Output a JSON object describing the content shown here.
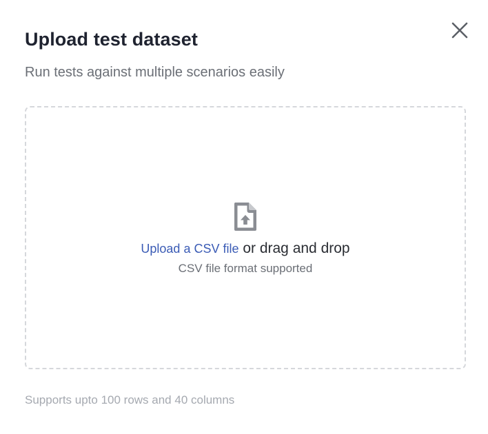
{
  "dialog": {
    "title": "Upload test dataset",
    "subtitle": "Run tests against multiple scenarios easily",
    "close_icon": "close-icon"
  },
  "dropzone": {
    "icon": "file-upload-icon",
    "upload_link": "Upload a CSV file",
    "drag_text": " or drag and drop",
    "hint": "CSV file format supported"
  },
  "footer": {
    "note": "Supports upto 100 rows and 40 columns"
  },
  "colors": {
    "link": "#3a5bb5",
    "title": "#1f2330",
    "muted": "#6b6f76",
    "border": "#d5d7db"
  }
}
